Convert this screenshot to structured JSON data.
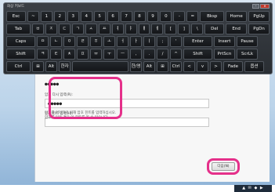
{
  "osk": {
    "title": "화상 키보드",
    "rows": [
      [
        "Esc",
        "~",
        "1",
        "2",
        "3",
        "4",
        "5",
        "6",
        "7",
        "8",
        "9",
        "0",
        "-",
        "=",
        "Bksp",
        "Home",
        "PgUp"
      ],
      [
        "Tab",
        "ㅂ",
        "ㅈ",
        "ㄷ",
        "ㄱ",
        "ㅅ",
        "ㅛ",
        "ㅕ",
        "ㅑ",
        "ㅐ",
        "ㅔ",
        "[",
        "]",
        "\\",
        "Del",
        "End",
        "PgDn"
      ],
      [
        "Caps",
        "ㅁ",
        "ㄴ",
        "ㅇ",
        "ㄹ",
        "ㅎ",
        "ㅗ",
        "ㅓ",
        "ㅏ",
        "ㅣ",
        ";",
        "'",
        "Enter",
        "Insert",
        "Pause"
      ],
      [
        "Shift",
        "ㅋ",
        "ㅌ",
        "ㅊ",
        "ㅍ",
        "ㅠ",
        "ㅜ",
        "ㅡ",
        ",",
        ".",
        "/",
        "^",
        "Shift",
        "PrtScn",
        "ScrLk"
      ],
      [
        "Ctrl",
        "⊞",
        "Alt",
        "한자",
        "",
        "한/영",
        "Alt",
        "⊞",
        "Ctrl",
        "<",
        "v",
        ">",
        "Fade",
        "옵션"
      ]
    ]
  },
  "dialog": {
    "password_mask_1": "●●●●●",
    "label_1": "암호 다시 입력(R):",
    "password_mask_2": "●●●●●",
    "label_2": "암호 힌트 입력(H):",
    "note_line_1": "암호를 기억하기 위해 암호 힌트를 입력하십시오.",
    "note_line_2": "암호를 잊은 경우 이 힌트를 볼 수 있습니다.",
    "ok_label": "다음(N)"
  },
  "taskbar": {
    "tray_text": "▲ ✉ ◆ ▶"
  },
  "colors": {
    "highlight": "#e5308a",
    "keyboard_bg": "#2a2e33"
  }
}
